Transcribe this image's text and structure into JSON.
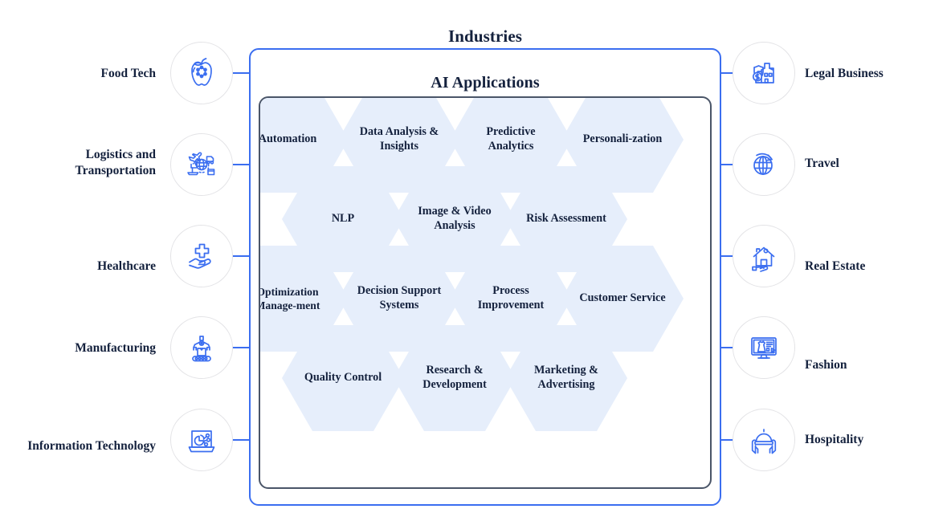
{
  "diagram": {
    "outer_title": "Industries",
    "inner_title": "AI Applications",
    "accent_color": "#3b6ef0",
    "hex_fill": "#e6eefb",
    "text_color": "#14213d",
    "inner_border_color": "#4a5568"
  },
  "hexagons": {
    "rows": [
      {
        "items": [
          "Automation",
          "Data Analysis & Insights",
          "Predictive Analytics",
          "Personali-zation"
        ]
      },
      {
        "items": [
          "NLP",
          "Image & Video Analysis",
          "Risk Assessment"
        ]
      },
      {
        "items": [
          "Optimization Manage-ment",
          "Decision Support Systems",
          "Process Improvement",
          "Customer Service"
        ]
      },
      {
        "items": [
          "Quality Control",
          "Research & Development",
          "Marketing & Advertising"
        ]
      }
    ],
    "flat": [
      "Automation",
      "Data Analysis & Insights",
      "Predictive Analytics",
      "Personali-zation",
      "NLP",
      "Image & Video Analysis",
      "Risk Assessment",
      "Optimization Manage-ment",
      "Decision Support Systems",
      "Process Improvement",
      "Customer Service",
      "Quality Control",
      "Research & Development",
      "Marketing & Advertising"
    ]
  },
  "industries_left": [
    {
      "label": "Food Tech",
      "icon": "apple-molecule-icon"
    },
    {
      "label": "Logistics and Transportation",
      "icon": "globe-plane-truck-ship-icon"
    },
    {
      "label": "Healthcare",
      "icon": "hand-medical-cross-icon"
    },
    {
      "label": "Manufacturing",
      "icon": "robot-arm-conveyor-icon"
    },
    {
      "label": "Information Technology",
      "icon": "laptop-analytics-icon"
    }
  ],
  "industries_right": [
    {
      "label": "Legal Business",
      "icon": "shield-building-dollar-icon"
    },
    {
      "label": "Travel",
      "icon": "globe-arrow-icon"
    },
    {
      "label": "Real Estate",
      "icon": "house-hand-icon"
    },
    {
      "label": "Fashion",
      "icon": "monitor-dress-icon"
    },
    {
      "label": "Hospitality",
      "icon": "hands-cloche-bell-icon"
    }
  ]
}
